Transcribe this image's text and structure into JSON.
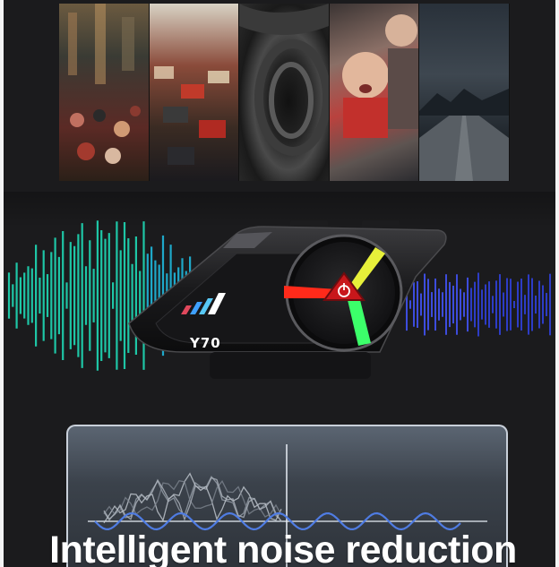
{
  "product": {
    "model_label": "Y70"
  },
  "caption": {
    "text": "Intelligent noise reduction"
  },
  "scenes": [
    "crowd",
    "traffic",
    "helmet-ear",
    "crying-child",
    "storm-road"
  ],
  "colors": {
    "wave_left": "#19d7c6",
    "wave_right": "#2f48e0",
    "led_red": "#ff2a1a",
    "led_yellow": "#e7f03a",
    "led_green": "#3cff6a",
    "panel_signal": "#4f7ce3"
  }
}
